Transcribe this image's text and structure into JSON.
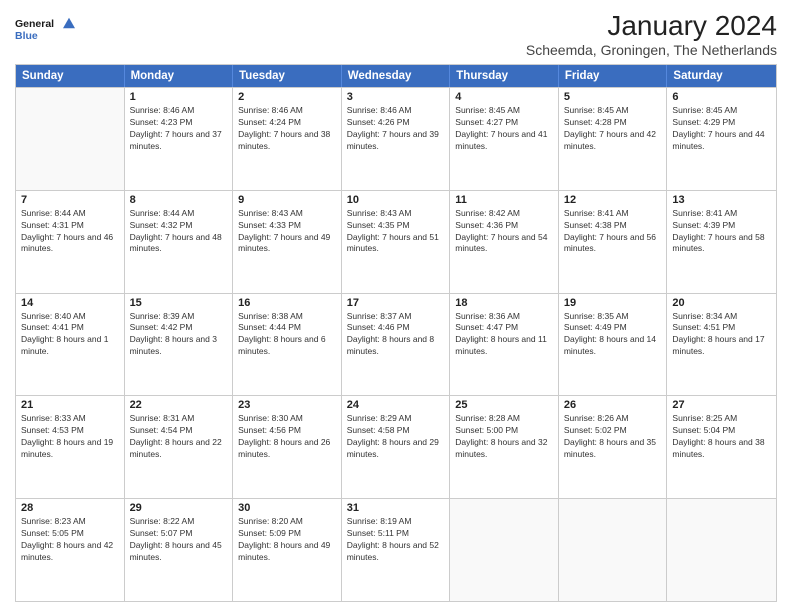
{
  "header": {
    "logo_line1": "General",
    "logo_line2": "Blue",
    "month": "January 2024",
    "location": "Scheemda, Groningen, The Netherlands"
  },
  "days_of_week": [
    "Sunday",
    "Monday",
    "Tuesday",
    "Wednesday",
    "Thursday",
    "Friday",
    "Saturday"
  ],
  "weeks": [
    [
      {
        "day": "",
        "empty": true
      },
      {
        "day": "1",
        "sunrise": "Sunrise: 8:46 AM",
        "sunset": "Sunset: 4:23 PM",
        "daylight": "Daylight: 7 hours and 37 minutes."
      },
      {
        "day": "2",
        "sunrise": "Sunrise: 8:46 AM",
        "sunset": "Sunset: 4:24 PM",
        "daylight": "Daylight: 7 hours and 38 minutes."
      },
      {
        "day": "3",
        "sunrise": "Sunrise: 8:46 AM",
        "sunset": "Sunset: 4:26 PM",
        "daylight": "Daylight: 7 hours and 39 minutes."
      },
      {
        "day": "4",
        "sunrise": "Sunrise: 8:45 AM",
        "sunset": "Sunset: 4:27 PM",
        "daylight": "Daylight: 7 hours and 41 minutes."
      },
      {
        "day": "5",
        "sunrise": "Sunrise: 8:45 AM",
        "sunset": "Sunset: 4:28 PM",
        "daylight": "Daylight: 7 hours and 42 minutes."
      },
      {
        "day": "6",
        "sunrise": "Sunrise: 8:45 AM",
        "sunset": "Sunset: 4:29 PM",
        "daylight": "Daylight: 7 hours and 44 minutes."
      }
    ],
    [
      {
        "day": "7",
        "sunrise": "Sunrise: 8:44 AM",
        "sunset": "Sunset: 4:31 PM",
        "daylight": "Daylight: 7 hours and 46 minutes."
      },
      {
        "day": "8",
        "sunrise": "Sunrise: 8:44 AM",
        "sunset": "Sunset: 4:32 PM",
        "daylight": "Daylight: 7 hours and 48 minutes."
      },
      {
        "day": "9",
        "sunrise": "Sunrise: 8:43 AM",
        "sunset": "Sunset: 4:33 PM",
        "daylight": "Daylight: 7 hours and 49 minutes."
      },
      {
        "day": "10",
        "sunrise": "Sunrise: 8:43 AM",
        "sunset": "Sunset: 4:35 PM",
        "daylight": "Daylight: 7 hours and 51 minutes."
      },
      {
        "day": "11",
        "sunrise": "Sunrise: 8:42 AM",
        "sunset": "Sunset: 4:36 PM",
        "daylight": "Daylight: 7 hours and 54 minutes."
      },
      {
        "day": "12",
        "sunrise": "Sunrise: 8:41 AM",
        "sunset": "Sunset: 4:38 PM",
        "daylight": "Daylight: 7 hours and 56 minutes."
      },
      {
        "day": "13",
        "sunrise": "Sunrise: 8:41 AM",
        "sunset": "Sunset: 4:39 PM",
        "daylight": "Daylight: 7 hours and 58 minutes."
      }
    ],
    [
      {
        "day": "14",
        "sunrise": "Sunrise: 8:40 AM",
        "sunset": "Sunset: 4:41 PM",
        "daylight": "Daylight: 8 hours and 1 minute."
      },
      {
        "day": "15",
        "sunrise": "Sunrise: 8:39 AM",
        "sunset": "Sunset: 4:42 PM",
        "daylight": "Daylight: 8 hours and 3 minutes."
      },
      {
        "day": "16",
        "sunrise": "Sunrise: 8:38 AM",
        "sunset": "Sunset: 4:44 PM",
        "daylight": "Daylight: 8 hours and 6 minutes."
      },
      {
        "day": "17",
        "sunrise": "Sunrise: 8:37 AM",
        "sunset": "Sunset: 4:46 PM",
        "daylight": "Daylight: 8 hours and 8 minutes."
      },
      {
        "day": "18",
        "sunrise": "Sunrise: 8:36 AM",
        "sunset": "Sunset: 4:47 PM",
        "daylight": "Daylight: 8 hours and 11 minutes."
      },
      {
        "day": "19",
        "sunrise": "Sunrise: 8:35 AM",
        "sunset": "Sunset: 4:49 PM",
        "daylight": "Daylight: 8 hours and 14 minutes."
      },
      {
        "day": "20",
        "sunrise": "Sunrise: 8:34 AM",
        "sunset": "Sunset: 4:51 PM",
        "daylight": "Daylight: 8 hours and 17 minutes."
      }
    ],
    [
      {
        "day": "21",
        "sunrise": "Sunrise: 8:33 AM",
        "sunset": "Sunset: 4:53 PM",
        "daylight": "Daylight: 8 hours and 19 minutes."
      },
      {
        "day": "22",
        "sunrise": "Sunrise: 8:31 AM",
        "sunset": "Sunset: 4:54 PM",
        "daylight": "Daylight: 8 hours and 22 minutes."
      },
      {
        "day": "23",
        "sunrise": "Sunrise: 8:30 AM",
        "sunset": "Sunset: 4:56 PM",
        "daylight": "Daylight: 8 hours and 26 minutes."
      },
      {
        "day": "24",
        "sunrise": "Sunrise: 8:29 AM",
        "sunset": "Sunset: 4:58 PM",
        "daylight": "Daylight: 8 hours and 29 minutes."
      },
      {
        "day": "25",
        "sunrise": "Sunrise: 8:28 AM",
        "sunset": "Sunset: 5:00 PM",
        "daylight": "Daylight: 8 hours and 32 minutes."
      },
      {
        "day": "26",
        "sunrise": "Sunrise: 8:26 AM",
        "sunset": "Sunset: 5:02 PM",
        "daylight": "Daylight: 8 hours and 35 minutes."
      },
      {
        "day": "27",
        "sunrise": "Sunrise: 8:25 AM",
        "sunset": "Sunset: 5:04 PM",
        "daylight": "Daylight: 8 hours and 38 minutes."
      }
    ],
    [
      {
        "day": "28",
        "sunrise": "Sunrise: 8:23 AM",
        "sunset": "Sunset: 5:05 PM",
        "daylight": "Daylight: 8 hours and 42 minutes."
      },
      {
        "day": "29",
        "sunrise": "Sunrise: 8:22 AM",
        "sunset": "Sunset: 5:07 PM",
        "daylight": "Daylight: 8 hours and 45 minutes."
      },
      {
        "day": "30",
        "sunrise": "Sunrise: 8:20 AM",
        "sunset": "Sunset: 5:09 PM",
        "daylight": "Daylight: 8 hours and 49 minutes."
      },
      {
        "day": "31",
        "sunrise": "Sunrise: 8:19 AM",
        "sunset": "Sunset: 5:11 PM",
        "daylight": "Daylight: 8 hours and 52 minutes."
      },
      {
        "day": "",
        "empty": true
      },
      {
        "day": "",
        "empty": true
      },
      {
        "day": "",
        "empty": true
      }
    ]
  ]
}
